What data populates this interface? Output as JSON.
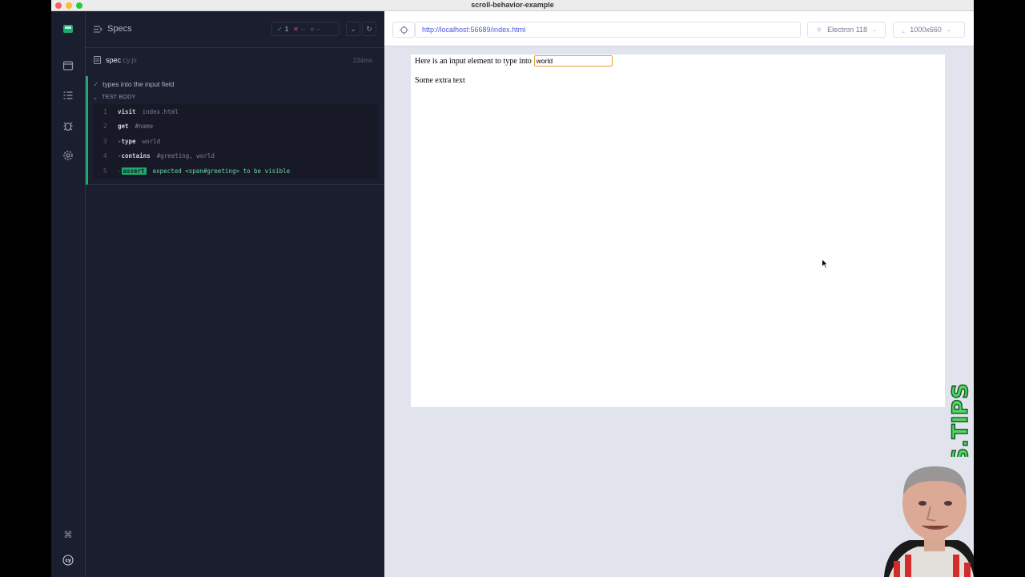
{
  "window": {
    "title": "scroll-behavior-example"
  },
  "reporter": {
    "header": {
      "specs_label": "Specs"
    },
    "stats": {
      "passed": "1",
      "failed": "--",
      "pending": "--"
    },
    "spec": {
      "name": "spec",
      "ext": ".cy.js",
      "duration": "234ms"
    },
    "test": {
      "title": "types into the input field",
      "body_label": "TEST BODY",
      "commands": [
        {
          "num": "1",
          "name": "visit",
          "arg": "index.html",
          "prefix": ""
        },
        {
          "num": "2",
          "name": "get",
          "arg": "#name",
          "prefix": ""
        },
        {
          "num": "3",
          "name": "type",
          "arg": "world",
          "prefix": "-"
        },
        {
          "num": "4",
          "name": "contains",
          "arg": "#greeting, world",
          "prefix": "-"
        },
        {
          "num": "5",
          "name": "assert",
          "arg": "expected <span#greeting> to be visible",
          "prefix": "-"
        }
      ]
    }
  },
  "aut": {
    "url": "http://localhost:56689/index.html",
    "browser": "Electron 118",
    "viewport": "1000x660",
    "page": {
      "line1": "Here is an input element to type into",
      "input_value": "world",
      "line2": "Some extra text"
    }
  },
  "watermark": {
    "text": "CYPRESS.TIPS"
  },
  "colors": {
    "pass": "#1fa971",
    "fail": "#e45770",
    "accent": "#4956e3",
    "nav_bg": "#1b1e2e"
  },
  "icons": [
    "cypress-logo-icon",
    "runs-icon",
    "specs-icon",
    "debug-icon",
    "settings-icon",
    "keyboard-shortcut-icon",
    "cy-logo-icon",
    "selector-playground-icon",
    "reload-icon",
    "chevron-down-icon"
  ]
}
